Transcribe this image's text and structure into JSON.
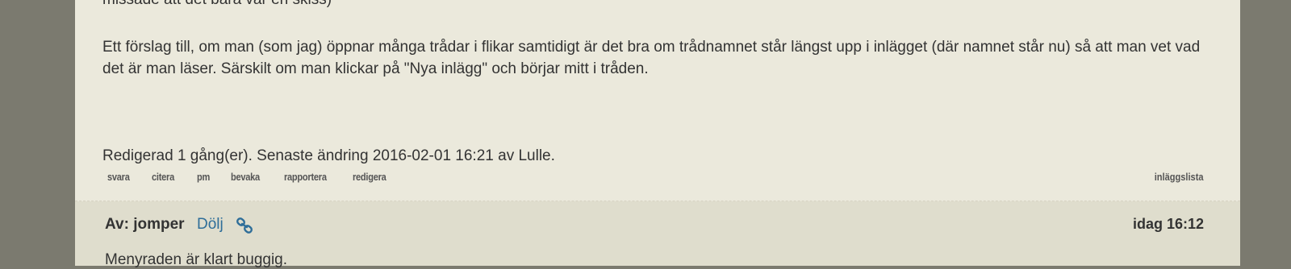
{
  "post1": {
    "clipped_line": "missade att det bara var en skiss)",
    "paragraph": "Ett förslag till, om man (som jag) öppnar många trådar i flikar samtidigt är det bra om trådnamnet står längst upp i inlägget (där namnet står nu) så att man vet vad det är man läser. Särskilt om man klickar på \"Nya inlägg\" och börjar mitt i tråden.",
    "edited_note": "Redigerad 1 gång(er). Senaste ändring 2016-02-01 16:21 av Lulle.",
    "actions": [
      "svara",
      "citera",
      "pm",
      "bevaka",
      "rapportera",
      "redigera"
    ],
    "post_list_link": "inläggslista"
  },
  "post2": {
    "author": "Av: jomper",
    "hide_link": "Dölj",
    "link_icon": "link-chain-icon",
    "time": "idag 16:12",
    "text_clipped": "Menyraden är klart buggig."
  },
  "colors": {
    "background": "#7b7a6f",
    "post_bg": "#ebe9dc",
    "post_header_bg": "#dfddcd",
    "link": "#2f6e99"
  }
}
